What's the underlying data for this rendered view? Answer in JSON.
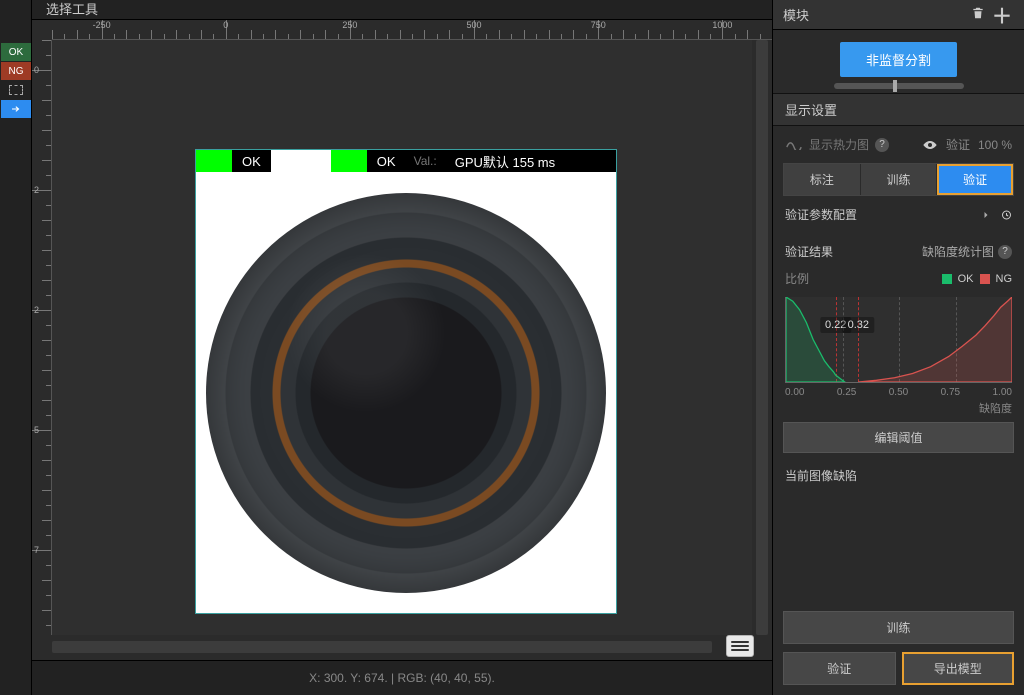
{
  "left": {
    "title": "选择工具",
    "ok_chip": "OK",
    "ng_chip": "NG"
  },
  "ruler": {
    "h_labels": [
      "-250",
      "0",
      "250",
      "500",
      "750",
      "1000"
    ],
    "v_labels": [
      "0",
      "2",
      "2",
      "5",
      "7"
    ]
  },
  "image": {
    "ok1": "OK",
    "ok2": "OK",
    "val_label": "Val.:",
    "gpu_label": "GPU默认 155 ms"
  },
  "status": {
    "text": "X: 300. Y: 674. | RGB: (40, 40, 55)."
  },
  "right": {
    "modules_title": "模块",
    "big_button": "非监督分割",
    "display_title": "显示设置",
    "heatmap_label": "显示热力图",
    "verify_label": "验证",
    "verify_pct": "100 %",
    "tabs": {
      "label": "标注",
      "train": "训练",
      "verify": "验证"
    },
    "verify_params": "验证参数配置",
    "verify_result": "验证结果",
    "defect_stat": "缺陷度统计图",
    "ratio": "比例",
    "legend_ok": "OK",
    "legend_ng": "NG",
    "y_label": "缺陷度",
    "edit_threshold": "编辑阈值",
    "current_defect": "当前图像缺陷",
    "bottom_train": "训练",
    "bottom_verify": "验证",
    "bottom_export": "导出模型"
  },
  "chart_data": {
    "type": "line",
    "xlabel": "",
    "ylabel": "缺陷度",
    "xlim": [
      0,
      1
    ],
    "ylim": [
      0,
      1
    ],
    "x_ticks": [
      "0.00",
      "0.25",
      "0.50",
      "0.75",
      "1.00"
    ],
    "thresholds": [
      0.22,
      0.32
    ],
    "threshold_labels": [
      "0.22",
      "0.32"
    ],
    "series": [
      {
        "name": "OK",
        "color": "#1abc6b",
        "x": [
          0.0,
          0.03,
          0.06,
          0.09,
          0.12,
          0.15,
          0.17,
          0.19,
          0.21,
          0.22,
          0.24,
          0.26
        ],
        "values": [
          1.0,
          0.95,
          0.85,
          0.7,
          0.5,
          0.35,
          0.25,
          0.18,
          0.12,
          0.08,
          0.04,
          0.0
        ]
      },
      {
        "name": "NG",
        "color": "#d9534f",
        "x": [
          0.32,
          0.4,
          0.48,
          0.56,
          0.64,
          0.72,
          0.78,
          0.84,
          0.88,
          0.92,
          0.95,
          0.98,
          1.0
        ],
        "values": [
          0.0,
          0.02,
          0.05,
          0.1,
          0.18,
          0.3,
          0.42,
          0.55,
          0.66,
          0.78,
          0.88,
          0.95,
          1.0
        ]
      }
    ]
  }
}
